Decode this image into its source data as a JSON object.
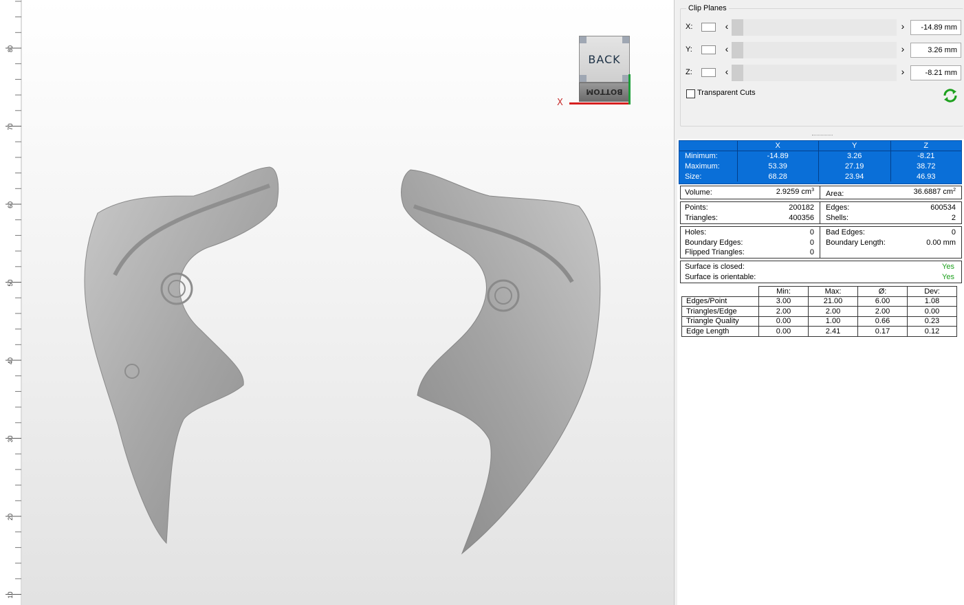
{
  "ruler": {
    "labels": [
      "80",
      "70",
      "60",
      "50",
      "40",
      "30",
      "20",
      "10"
    ]
  },
  "viewport": {
    "nav_cube": {
      "front_label": "BACK",
      "bottom_label": "BOTTOM",
      "axis_label": "X"
    }
  },
  "clip_planes": {
    "title": "Clip Planes",
    "rows": [
      {
        "axis": "X:",
        "value": "-14.89 mm"
      },
      {
        "axis": "Y:",
        "value": "3.26 mm"
      },
      {
        "axis": "Z:",
        "value": "-8.21 mm"
      }
    ],
    "transparent_cuts": {
      "label": "Transparent Cuts",
      "checked": false
    }
  },
  "bounding_box": {
    "headers": [
      "X",
      "Y",
      "Z"
    ],
    "rows": [
      {
        "label": "Minimum:",
        "values": [
          "-14.89",
          "3.26",
          "-8.21"
        ]
      },
      {
        "label": "Maximum:",
        "values": [
          "53.39",
          "27.19",
          "38.72"
        ]
      },
      {
        "label": "Size:",
        "values": [
          "68.28",
          "23.94",
          "46.93"
        ]
      }
    ]
  },
  "volume": {
    "label": "Volume:",
    "value": "2.9259 cm",
    "unit_sup": "3"
  },
  "area": {
    "label": "Area:",
    "value": "36.6887 cm",
    "unit_sup": "2"
  },
  "mesh_counts": {
    "points_label": "Points:",
    "points": "200182",
    "triangles_label": "Triangles:",
    "triangles": "400356",
    "edges_label": "Edges:",
    "edges": "600534",
    "shells_label": "Shells:",
    "shells": "2"
  },
  "errors": {
    "holes_label": "Holes:",
    "holes": "0",
    "boundary_edges_label": "Boundary Edges:",
    "boundary_edges": "0",
    "flipped_label": "Flipped Triangles:",
    "flipped": "0",
    "bad_edges_label": "Bad Edges:",
    "bad_edges": "0",
    "boundary_length_label": "Boundary Length:",
    "boundary_length": "0.00 mm"
  },
  "surface": {
    "closed_label": "Surface is closed:",
    "closed": "Yes",
    "orientable_label": "Surface is orientable:",
    "orientable": "Yes",
    "status_color": "#1ea01e"
  },
  "quality": {
    "headers": [
      "Min:",
      "Max:",
      "Ø:",
      "Dev:"
    ],
    "rows": [
      {
        "label": "Edges/Point",
        "values": [
          "3.00",
          "21.00",
          "6.00",
          "1.08"
        ]
      },
      {
        "label": "Triangles/Edge",
        "values": [
          "2.00",
          "2.00",
          "2.00",
          "0.00"
        ]
      },
      {
        "label": "Triangle Quality",
        "values": [
          "0.00",
          "1.00",
          "0.66",
          "0.23"
        ]
      },
      {
        "label": "Edge Length",
        "values": [
          "0.00",
          "2.41",
          "0.17",
          "0.12"
        ]
      }
    ]
  },
  "colors": {
    "table_highlight": "#0a6fd8",
    "refresh_icon": "#1ea01e",
    "x_axis": "#d62020",
    "y_axis": "#1e9e3a"
  }
}
